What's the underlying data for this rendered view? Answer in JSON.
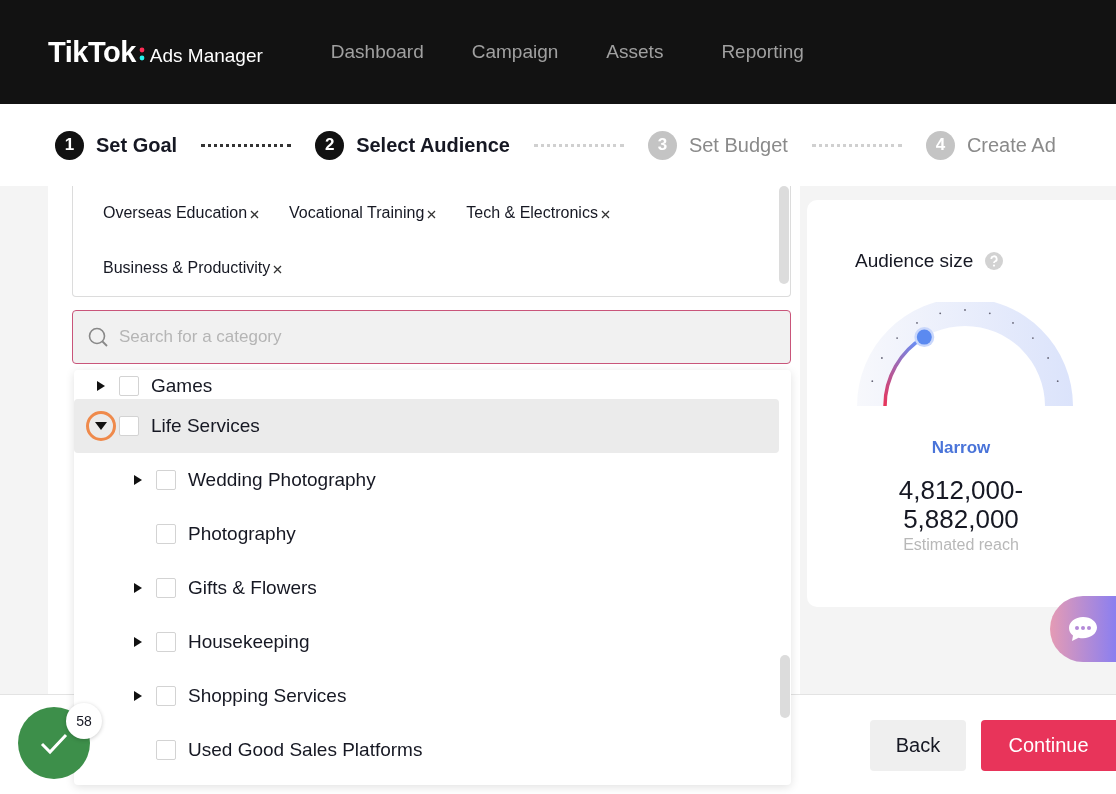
{
  "header": {
    "logo": "TikTok",
    "product": "Ads Manager",
    "nav": [
      {
        "label": "Dashboard"
      },
      {
        "label": "Campaign"
      },
      {
        "label": "Assets"
      },
      {
        "label": "Reporting"
      }
    ]
  },
  "steps": [
    {
      "number": "1",
      "label": "Set Goal",
      "active": true
    },
    {
      "number": "2",
      "label": "Select Audience",
      "active": true
    },
    {
      "number": "3",
      "label": "Set Budget",
      "active": false
    },
    {
      "number": "4",
      "label": "Create Ad",
      "active": false
    }
  ],
  "selected_tags": [
    {
      "label": "Overseas Education"
    },
    {
      "label": "Vocational Training"
    },
    {
      "label": "Tech & Electronics"
    },
    {
      "label": "Business & Productivity"
    }
  ],
  "search": {
    "placeholder": "Search for a category"
  },
  "category_tree": [
    {
      "label": "Games",
      "kind": "collapsed",
      "checked": false,
      "selected": false,
      "marked": false
    },
    {
      "label": "Life Services",
      "kind": "expanded",
      "checked": false,
      "selected": true,
      "marked": true,
      "children": [
        {
          "label": "Wedding Photography",
          "kind": "collapsed",
          "checked": false,
          "selected": false,
          "marked": false
        },
        {
          "label": "Photography",
          "kind": "leaf",
          "checked": false,
          "selected": false,
          "marked": false
        },
        {
          "label": "Gifts & Flowers",
          "kind": "collapsed",
          "checked": false,
          "selected": false,
          "marked": false
        },
        {
          "label": "Housekeeping",
          "kind": "collapsed",
          "checked": false,
          "selected": false,
          "marked": false
        },
        {
          "label": "Shopping Services",
          "kind": "collapsed",
          "checked": false,
          "selected": false,
          "marked": false
        },
        {
          "label": "Used Good Sales Platforms",
          "kind": "leaf",
          "checked": false,
          "selected": false,
          "marked": false
        }
      ]
    }
  ],
  "audience": {
    "title": "Audience size",
    "level": 0.33,
    "rating": "Narrow",
    "reach_line_1": "4,812,000-",
    "reach_line_2": "5,882,000",
    "reach_caption": "Estimated reach"
  },
  "footer": {
    "buttons": [
      {
        "label": "Back",
        "kind": "secondary"
      },
      {
        "label": "Continue",
        "kind": "primary"
      }
    ]
  },
  "progress_badge": {
    "count": "58"
  }
}
